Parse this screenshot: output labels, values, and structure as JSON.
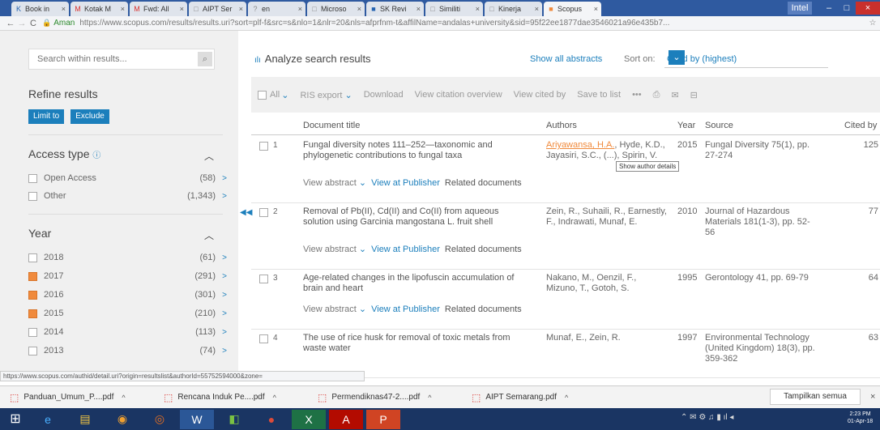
{
  "browser": {
    "tabs": [
      {
        "label": "Book in",
        "icon": "K",
        "color": "#2563b0"
      },
      {
        "label": "Kotak M",
        "icon": "M",
        "color": "#d9302c"
      },
      {
        "label": "Fwd: All",
        "icon": "M",
        "color": "#d9302c"
      },
      {
        "label": "AIPT Ser",
        "icon": "□",
        "color": "#888"
      },
      {
        "label": "en",
        "icon": "?",
        "color": "#888"
      },
      {
        "label": "Microso",
        "icon": "□",
        "color": "#888"
      },
      {
        "label": "SK Revi",
        "icon": "■",
        "color": "#2563b0"
      },
      {
        "label": "Similiti",
        "icon": "□",
        "color": "#888"
      },
      {
        "label": "Kinerja",
        "icon": "□",
        "color": "#888"
      },
      {
        "label": "Scopus",
        "icon": "■",
        "color": "#f08a3c"
      }
    ],
    "close_glyph": "×",
    "controls": {
      "user": "Intel",
      "minimize": "–",
      "maximize": "□",
      "close": "×"
    },
    "nav": {
      "back": "←",
      "forward": "→",
      "reload": "C"
    },
    "secure_label": "Aman",
    "url": "https://www.scopus.com/results/results.uri?sort=plf-f&src=s&nlo=1&nlr=20&nls=afprfnm-t&affilName=andalas+university&sid=95f22ee1877dae3546021a96e435b7...",
    "star": "☆"
  },
  "sidebar": {
    "search_placeholder": "Search within results...",
    "search_icon": "⌕",
    "refine_title": "Refine results",
    "limit_label": "Limit to",
    "exclude_label": "Exclude",
    "access": {
      "title": "Access type",
      "info": "ⓘ",
      "chevron": "︿",
      "items": [
        {
          "label": "Open Access",
          "count": "(58)"
        },
        {
          "label": "Other",
          "count": "(1,343)"
        }
      ]
    },
    "year": {
      "title": "Year",
      "chevron": "︿",
      "items": [
        {
          "label": "2018",
          "count": "(61)",
          "orange": false
        },
        {
          "label": "2017",
          "count": "(291)",
          "orange": true
        },
        {
          "label": "2016",
          "count": "(301)",
          "orange": true
        },
        {
          "label": "2015",
          "count": "(210)",
          "orange": true
        },
        {
          "label": "2014",
          "count": "(113)",
          "orange": false
        },
        {
          "label": "2013",
          "count": "(74)",
          "orange": false
        }
      ]
    },
    "arrow": ">"
  },
  "main": {
    "analyze_icon": "ılı",
    "analyze_label": "Analyze search results",
    "show_abstracts": "Show all abstracts",
    "sort_on": "Sort on:",
    "sort_value": "Cited by (highest)",
    "sort_dd": "⌄",
    "toolbar": {
      "all": "All",
      "all_chev": "⌄",
      "ris": "RIS export",
      "ris_chev": "⌄",
      "download": "Download",
      "overview": "View citation overview",
      "cited_by": "View cited by",
      "save": "Save to list",
      "more": "•••",
      "print": "⎙",
      "email": "✉",
      "bib": "⊟"
    },
    "columns": {
      "title": "Document title",
      "authors": "Authors",
      "year": "Year",
      "source": "Source",
      "cited": "Cited by"
    },
    "collapse": "◀◀",
    "rows": [
      {
        "num": "1",
        "title": "Fungal diversity notes 111–252—taxonomic and phylogenetic contributions to fungal taxa",
        "author_link": "Ariyawansa, H.A.",
        "authors_rest": ", Hyde, K.D., Jayasiri, S.C., (...), Spirin, V.",
        "year": "2015",
        "source": "Fungal Diversity 75(1), pp. 27-274",
        "cited": "125"
      },
      {
        "num": "2",
        "title": "Removal of Pb(II), Cd(II) and Co(II) from aqueous solution using Garcinia mangostana L. fruit shell",
        "author_link": "",
        "authors_rest": "Zein, R., Suhaili, R., Earnestly, F., Indrawati, Munaf, E.",
        "year": "2010",
        "source": "Journal of Hazardous Materials 181(1-3), pp. 52-56",
        "cited": "77"
      },
      {
        "num": "3",
        "title": "Age-related changes in the lipofuscin accumulation of brain and heart",
        "author_link": "",
        "authors_rest": "Nakano, M., Oenzil, F., Mizuno, T., Gotoh, S.",
        "year": "1995",
        "source": "Gerontology 41, pp. 69-79",
        "cited": "64"
      },
      {
        "num": "4",
        "title": "The use of rice husk for removal of toxic metals from waste water",
        "author_link": "",
        "authors_rest": "Munaf, E., Zein, R.",
        "year": "1997",
        "source": "Environmental Technology (United Kingdom) 18(3), pp. 359-362",
        "cited": "63"
      }
    ],
    "links": {
      "abstract": "View abstract",
      "abstract_chev": "⌄",
      "publisher": "View at Publisher",
      "related": "Related documents"
    },
    "tooltip": "Show author details"
  },
  "status_url": "https://www.scopus.com/authid/detail.uri?origin=resultslist&authorId=55752594000&zone=",
  "downloads": {
    "items": [
      {
        "name": "Panduan_Umum_P....pdf"
      },
      {
        "name": "Rencana Induk Pe....pdf"
      },
      {
        "name": "Permendiknas47-2....pdf"
      },
      {
        "name": "AIPT Semarang.pdf"
      }
    ],
    "pdf_icon": "⬚",
    "up": "^",
    "show_all": "Tampilkan semua",
    "close": "×"
  },
  "taskbar": {
    "start": "⊞",
    "apps": [
      {
        "name": "ie",
        "glyph": "e",
        "bg": "#1a3563",
        "color": "#4ab0ff"
      },
      {
        "name": "explorer",
        "glyph": "▤",
        "bg": "#1a3563",
        "color": "#f3c540"
      },
      {
        "name": "paint",
        "glyph": "◉",
        "bg": "#1a3563",
        "color": "#f0a030"
      },
      {
        "name": "firefox",
        "glyph": "◎",
        "bg": "#1a3563",
        "color": "#e87020"
      },
      {
        "name": "word",
        "glyph": "W",
        "bg": "#2b5797",
        "color": "#fff"
      },
      {
        "name": "app",
        "glyph": "◧",
        "bg": "#1a3563",
        "color": "#7ac143"
      },
      {
        "name": "chrome",
        "glyph": "●",
        "bg": "#1a3563",
        "color": "#dd4b39"
      },
      {
        "name": "excel",
        "glyph": "X",
        "bg": "#1e7145",
        "color": "#fff"
      },
      {
        "name": "acrobat",
        "glyph": "A",
        "bg": "#b30b00",
        "color": "#fff"
      },
      {
        "name": "powerpoint",
        "glyph": "P",
        "bg": "#d04423",
        "color": "#fff"
      }
    ],
    "tray": "⌃  ✉  ⚙  ♫  ▮  ıl  ◂",
    "time": "2:23 PM",
    "date": "01-Apr-18"
  }
}
